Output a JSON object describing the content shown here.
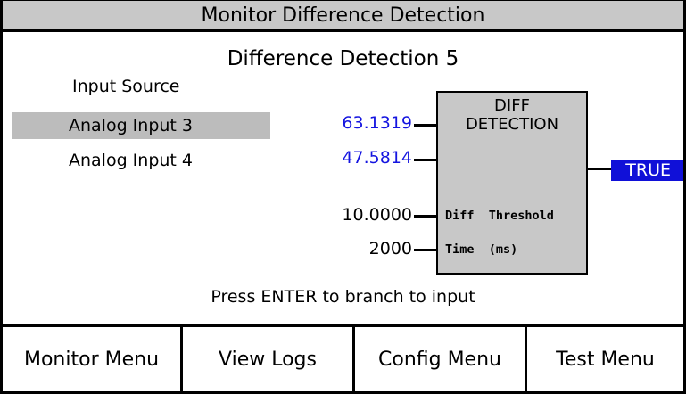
{
  "title": "Monitor Difference Detection",
  "subtitle": "Difference Detection 5",
  "input_source_label": "Input Source",
  "inputs": [
    {
      "label": "Analog Input 3",
      "value": "63.1319",
      "selected": true
    },
    {
      "label": "Analog Input 4",
      "value": "47.5814",
      "selected": false
    }
  ],
  "block": {
    "title_line1": "DIFF",
    "title_line2": "DETECTION",
    "threshold_label": "Diff  Threshold",
    "threshold_value": "10.0000",
    "time_label": "Time  (ms)",
    "time_value": "2000"
  },
  "output": "TRUE",
  "hint": "Press ENTER to branch to input",
  "menu": [
    {
      "label": "Monitor Menu"
    },
    {
      "label": "View Logs"
    },
    {
      "label": "Config Menu"
    },
    {
      "label": "Test Menu"
    }
  ],
  "colors": {
    "title_bg": "#c8c8c8",
    "selected_row": "#bcbcbc",
    "value_blue": "#1515e0",
    "badge_blue": "#1010d8"
  }
}
